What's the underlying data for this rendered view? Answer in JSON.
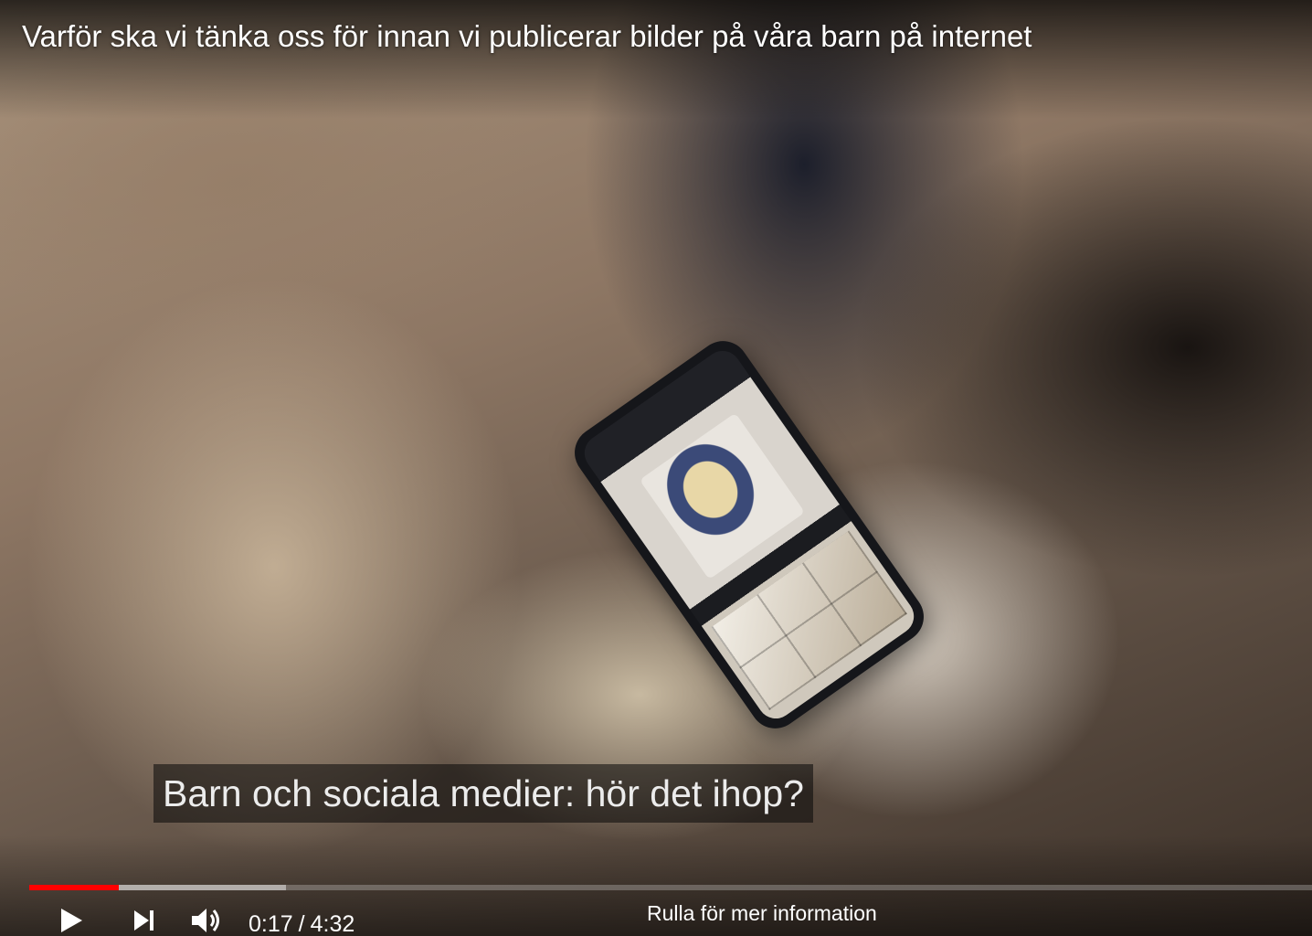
{
  "video": {
    "title": "Varför ska vi tänka oss för innan vi publicerar bilder på våra barn på internet",
    "subtitle": "Barn och sociala medier: hör det ihop?"
  },
  "progress": {
    "played_fraction": 0.07,
    "buffered_fraction": 0.2
  },
  "controls": {
    "play_icon": "play-icon",
    "next_icon": "next-icon",
    "volume_icon": "volume-icon",
    "current_time": "0:17",
    "separator": "/",
    "duration": "4:32"
  },
  "scroll_hint": "Rulla för mer information",
  "colors": {
    "progress_played": "#ff0000",
    "text": "#ffffff"
  }
}
